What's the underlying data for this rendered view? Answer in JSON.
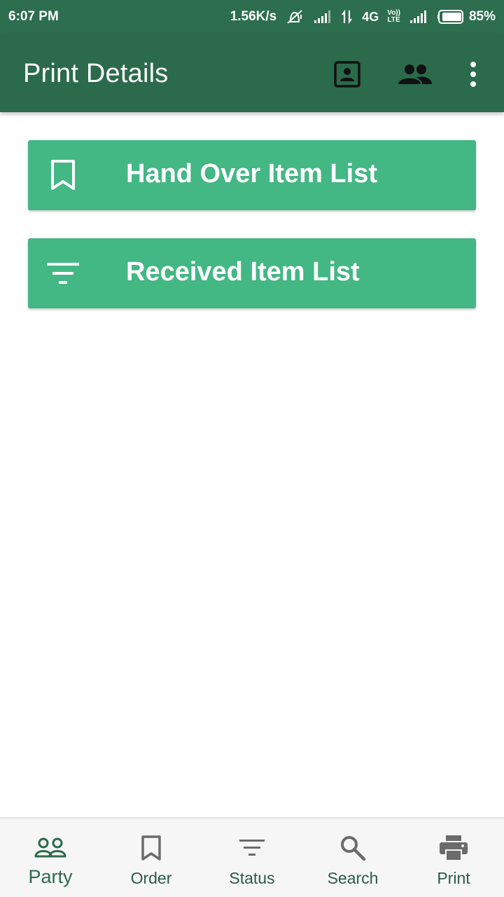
{
  "status_bar": {
    "time": "6:07 PM",
    "speed": "1.56K/s",
    "network": "4G",
    "volte_top": "Vo))",
    "volte_bottom": "LTE",
    "battery": "85%",
    "icons": [
      "alarm-off-icon",
      "signal-icon",
      "data-arrows-icon",
      "signal-icon",
      "battery-icon"
    ]
  },
  "app_bar": {
    "title": "Print Details",
    "icons": [
      "contact-icon",
      "group-icon",
      "more-vert-icon"
    ],
    "color": "#2b6a4b"
  },
  "actions": [
    {
      "label": "Hand Over Item List",
      "icon": "bookmark-icon"
    },
    {
      "label": "Received Item List",
      "icon": "filter-icon"
    }
  ],
  "bottom_nav": {
    "items": [
      {
        "label": "Party",
        "icon": "people-outline-icon",
        "active": true
      },
      {
        "label": "Order",
        "icon": "bookmark-icon",
        "active": false
      },
      {
        "label": "Status",
        "icon": "filter-icon",
        "active": false
      },
      {
        "label": "Search",
        "icon": "search-icon",
        "active": false
      },
      {
        "label": "Print",
        "icon": "printer-icon",
        "active": false
      }
    ]
  },
  "colors": {
    "primary": "#2b6a4b",
    "button": "#43b784",
    "nav_bg": "#f6f6f6"
  }
}
